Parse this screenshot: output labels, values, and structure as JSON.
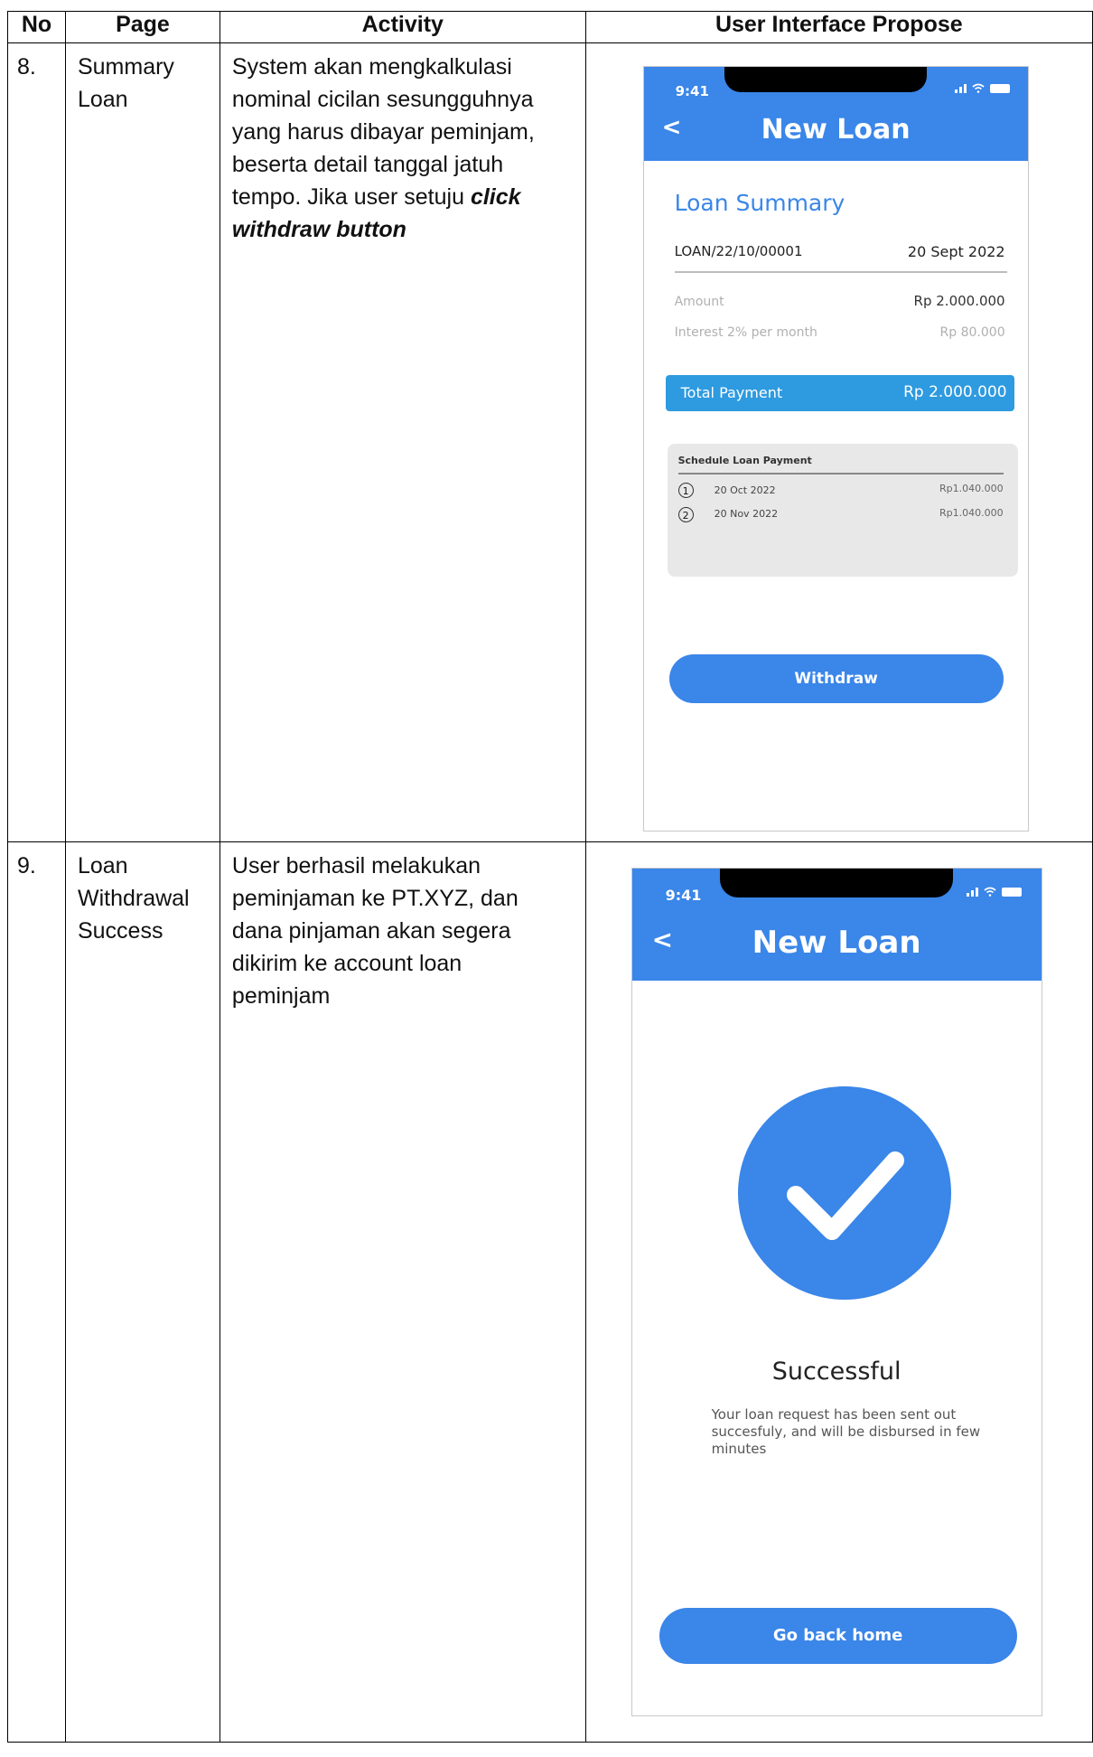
{
  "table": {
    "headers": [
      "No",
      "Page",
      "Activity",
      "User Interface Propose"
    ],
    "rows": [
      {
        "no": "8.",
        "page_lines": [
          "Summary",
          "Loan"
        ],
        "activity_lines": [
          "System akan mengkalkulasi",
          "nominal cicilan sesungguhnya",
          "yang harus dibayar peminjam,",
          "beserta detail tanggal jatuh",
          "tempo. Jika user setuju"
        ],
        "activity_emphasis": [
          "click",
          "withdraw button"
        ]
      },
      {
        "no": "9.",
        "page_lines": [
          "Loan",
          "Withdrawal",
          "Success"
        ],
        "activity_lines": [
          "User berhasil melakukan",
          "peminjaman ke PT.XYZ, dan",
          "dana pinjaman akan segera",
          "dikirim ke account loan",
          "peminjam"
        ]
      }
    ]
  },
  "summary_screen": {
    "time": "9:41",
    "back_label": "<",
    "header_title": "New Loan",
    "section_title": "Loan Summary",
    "loan_id": "LOAN/22/10/00001",
    "loan_date": "20 Sept 2022",
    "amount_label": "Amount",
    "amount_value": "Rp 2.000.000",
    "interest_label": "Interest 2% per month",
    "interest_value": "Rp 80.000",
    "total_label": "Total Payment",
    "total_value": "Rp 2.000.000",
    "schedule_title": "Schedule Loan Payment",
    "schedule": [
      {
        "num": "1",
        "date": "20 Oct 2022",
        "amount": "Rp1.040.000"
      },
      {
        "num": "2",
        "date": "20 Nov 2022",
        "amount": "Rp1.040.000"
      }
    ],
    "withdraw_label": "Withdraw"
  },
  "success_screen": {
    "time": "9:41",
    "back_label": "<",
    "header_title": "New Loan",
    "title": "Successful",
    "message_lines": [
      "Your loan request has been sent out",
      "succesfuly, and will be disbursed in few",
      "minutes"
    ],
    "home_label": "Go back home"
  },
  "colors": {
    "primary": "#3a86e9",
    "total_bar": "#2e9ae0",
    "schedule_bg": "#e8e8e8"
  }
}
